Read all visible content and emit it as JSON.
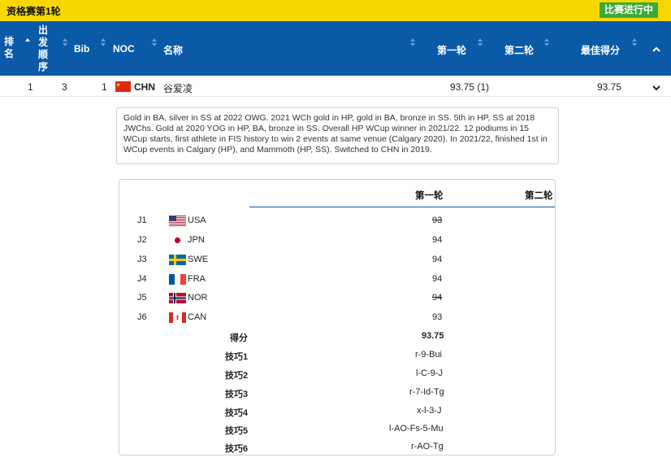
{
  "header": {
    "stage_title": "资格赛第1轮",
    "live_badge": "比赛进行中"
  },
  "columns": {
    "rank": "排名",
    "start_order": "出发顺序",
    "bib": "Bib",
    "noc": "NOC",
    "name": "名称",
    "run1": "第一轮",
    "run2": "第二轮",
    "best": "最佳得分"
  },
  "athlete": {
    "rank": "1",
    "start_order": "3",
    "bib": "1",
    "noc": "CHN",
    "name": "谷爱凌",
    "run1": "93.75 (1)",
    "run2": "",
    "best": "93.75",
    "bio": "Gold in BA, silver in SS at 2022 OWG. 2021 WCh gold in HP, gold in BA, bronze in SS. 5th in HP, SS at 2018 JWChs. Gold at 2020 YOG in HP, BA, bronze in SS. Overall HP WCup winner in 2021/22. 12 podiums in 15 WCup starts, first athlete in FIS history to win 2 events at same venue (Calgary 2020). In 2021/22, finished 1st in WCup events in Calgary (HP), and Mammoth (HP, SS). Switched to CHN in 2019."
  },
  "detail": {
    "run1_header": "第一轮",
    "run2_header": "第二轮",
    "judges": [
      {
        "id": "J1",
        "noc": "USA",
        "score": "93",
        "struck": true
      },
      {
        "id": "J2",
        "noc": "JPN",
        "score": "94",
        "struck": false
      },
      {
        "id": "J3",
        "noc": "SWE",
        "score": "94",
        "struck": false
      },
      {
        "id": "J4",
        "noc": "FRA",
        "score": "94",
        "struck": false
      },
      {
        "id": "J5",
        "noc": "NOR",
        "score": "94",
        "struck": true
      },
      {
        "id": "J6",
        "noc": "CAN",
        "score": "93",
        "struck": false
      }
    ],
    "score_label": "得分",
    "score_value": "93.75",
    "tricks": [
      {
        "label": "技巧1",
        "value": "r-9-Bui"
      },
      {
        "label": "技巧2",
        "value": "l-C-9-J"
      },
      {
        "label": "技巧3",
        "value": "r-7-Id-Tg"
      },
      {
        "label": "技巧4",
        "value": "x-l-3-J"
      },
      {
        "label": "技巧5",
        "value": "l-AO-Fs-5-Mu"
      },
      {
        "label": "技巧6",
        "value": "r-AO-Tg"
      }
    ]
  },
  "colors": {
    "header_yellow": "#f6d800",
    "table_blue": "#0a5aa8",
    "live_green": "#3aa935"
  }
}
